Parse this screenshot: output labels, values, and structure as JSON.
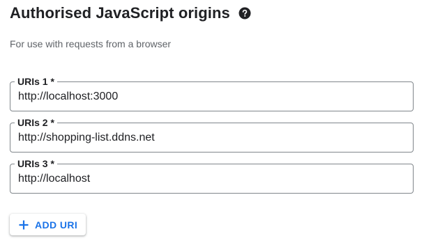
{
  "section": {
    "title": "Authorised JavaScript origins",
    "help_icon": "help-circle-icon",
    "subtitle": "For use with requests from a browser"
  },
  "uris": [
    {
      "label": "URIs 1 *",
      "value": "http://localhost:3000"
    },
    {
      "label": "URIs 2 *",
      "value": "http://shopping-list.ddns.net"
    },
    {
      "label": "URIs 3 *",
      "value": "http://localhost"
    }
  ],
  "add_button": {
    "icon": "plus-icon",
    "label": "ADD URI"
  },
  "colors": {
    "accent": "#1a73e8",
    "text": "#202124",
    "secondary_text": "#5f6368",
    "border": "#80868b"
  }
}
